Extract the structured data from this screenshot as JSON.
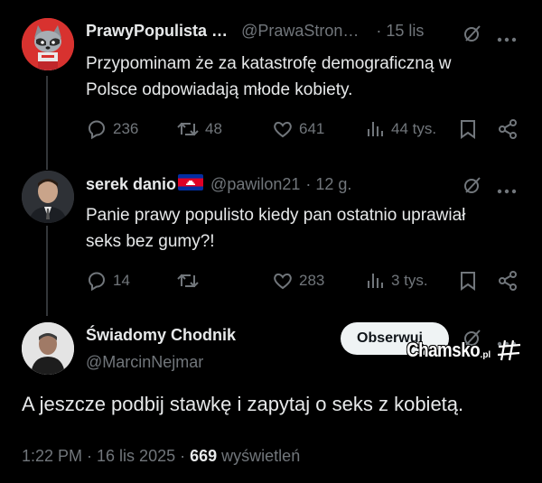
{
  "tweets": [
    {
      "name": "PrawyPopulista …",
      "handle": "@PrawaStron…",
      "time": "· 15 lis",
      "text_lines": [
        "Przypominam że za katastrofę demograficzną w",
        "Polsce odpowiadają młode kobiety."
      ],
      "replies": "236",
      "retweets": "48",
      "likes": "641",
      "views": "44 tys."
    },
    {
      "name": "serek danio",
      "handle": "@pawilon21",
      "time": "· 12 g.",
      "text_lines": [
        "Panie prawy populisto kiedy pan ostatnio uprawiał",
        "seks bez gumy?!"
      ],
      "replies": "14",
      "retweets": "",
      "likes": "283",
      "views": "3 tys."
    }
  ],
  "main_tweet": {
    "name": "Świadomy Chodnik",
    "handle": "@MarcinNejmar",
    "follow_label": "Obserwuj",
    "text": "A jeszcze podbij stawkę i zapytaj o seks z kobietą.",
    "time": "1:22 PM · 16 lis 2025 ·",
    "views_count": "669",
    "views_label": "wyświetleń"
  },
  "watermark": {
    "main": "Chamsko",
    "tld": ".pl"
  },
  "colors": {
    "background": "#000000",
    "text": "#e7e9ea",
    "muted": "#71767b",
    "thread_line": "#333639",
    "follow_button": "#eff3f4"
  },
  "icons": [
    "reply-icon",
    "retweet-icon",
    "like-icon",
    "views-icon",
    "bookmark-icon",
    "share-icon",
    "grok-icon",
    "more-icon",
    "cambodia-flag-icon"
  ]
}
